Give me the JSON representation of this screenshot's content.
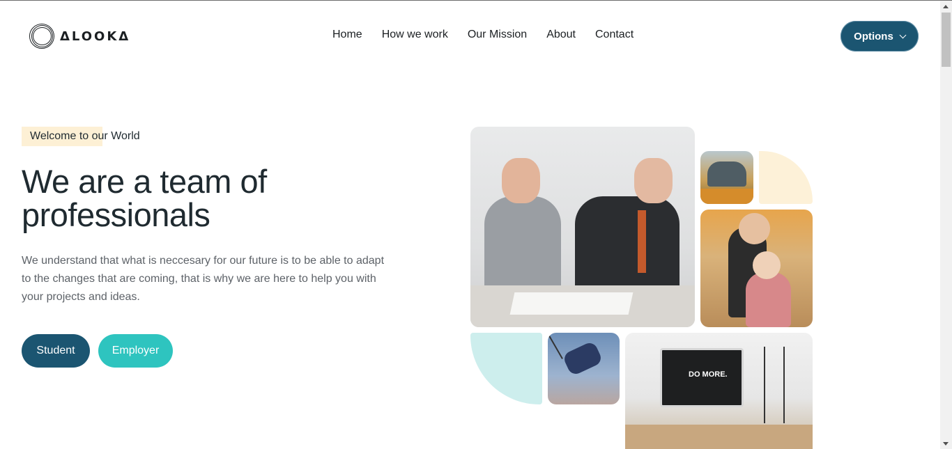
{
  "header": {
    "logo_text": "ΔLOOKΔ",
    "nav": [
      "Home",
      "How we work",
      "Our Mission",
      "About",
      "Contact"
    ],
    "options_label": "Options"
  },
  "hero": {
    "badge": "Welcome to our World",
    "headline": "We are a team of professionals",
    "description": "We understand that what is neccesary for our future is to be able to adapt to the changes that are coming, that is why we are here to help you with your projects and ideas.",
    "buttons": {
      "student": "Student",
      "employer": "Employer"
    }
  },
  "gallery": {
    "desk_screen_text": "DO MORE."
  },
  "colors": {
    "primary": "#1b5571",
    "accent": "#2ec4bf",
    "cream": "#fdf1d8",
    "teal_light": "#cdeeed"
  }
}
